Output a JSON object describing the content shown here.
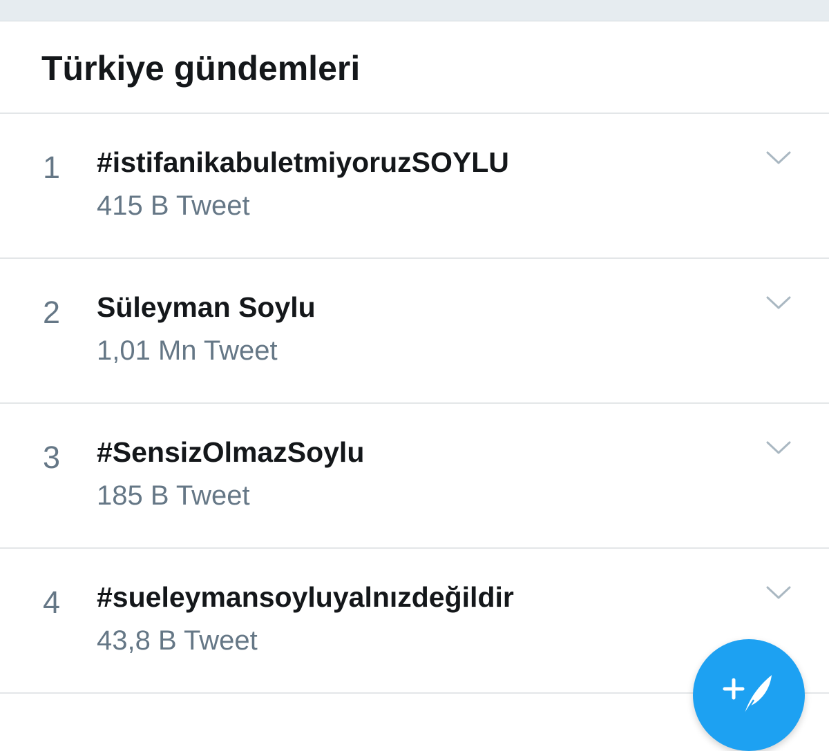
{
  "header": {
    "title": "Türkiye gündemleri"
  },
  "trends": [
    {
      "rank": "1",
      "name": "#istifanikabuletmiyoruzSOYLU",
      "count": "415 B Tweet"
    },
    {
      "rank": "2",
      "name": "Süleyman Soylu",
      "count": "1,01 Mn Tweet"
    },
    {
      "rank": "3",
      "name": "#SensizOlmazSoylu",
      "count": "185 B Tweet"
    },
    {
      "rank": "4",
      "name": "#sueleymansoyluyalnızdeğildir",
      "count": "43,8 B Tweet"
    }
  ],
  "icons": {
    "chevron": "chevron-down-icon",
    "compose": "compose-tweet-icon"
  },
  "colors": {
    "accent": "#1da1f2",
    "text_primary": "#14171a",
    "text_secondary": "#657786",
    "divider": "#e3e6e8",
    "top_strip": "#e6ecf0"
  }
}
